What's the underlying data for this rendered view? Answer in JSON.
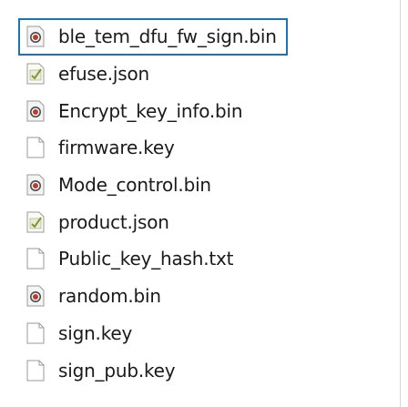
{
  "files": [
    {
      "name": "ble_tem_dfu_fw_sign.bin",
      "icon": "bin-file-icon",
      "selected": true
    },
    {
      "name": "efuse.json",
      "icon": "json-file-icon",
      "selected": false
    },
    {
      "name": "Encrypt_key_info.bin",
      "icon": "bin-file-icon",
      "selected": false
    },
    {
      "name": "firmware.key",
      "icon": "blank-file-icon",
      "selected": false
    },
    {
      "name": "Mode_control.bin",
      "icon": "bin-file-icon",
      "selected": false
    },
    {
      "name": "product.json",
      "icon": "json-file-icon",
      "selected": false
    },
    {
      "name": "Public_key_hash.txt",
      "icon": "blank-file-icon",
      "selected": false
    },
    {
      "name": "random.bin",
      "icon": "bin-file-icon",
      "selected": false
    },
    {
      "name": "sign.key",
      "icon": "blank-file-icon",
      "selected": false
    },
    {
      "name": "sign_pub.key",
      "icon": "blank-file-icon",
      "selected": false
    }
  ],
  "colors": {
    "selection_border": "#1a73b5",
    "bin_icon_dot": "#c0392b",
    "json_icon_check": "#7a9a2a"
  }
}
